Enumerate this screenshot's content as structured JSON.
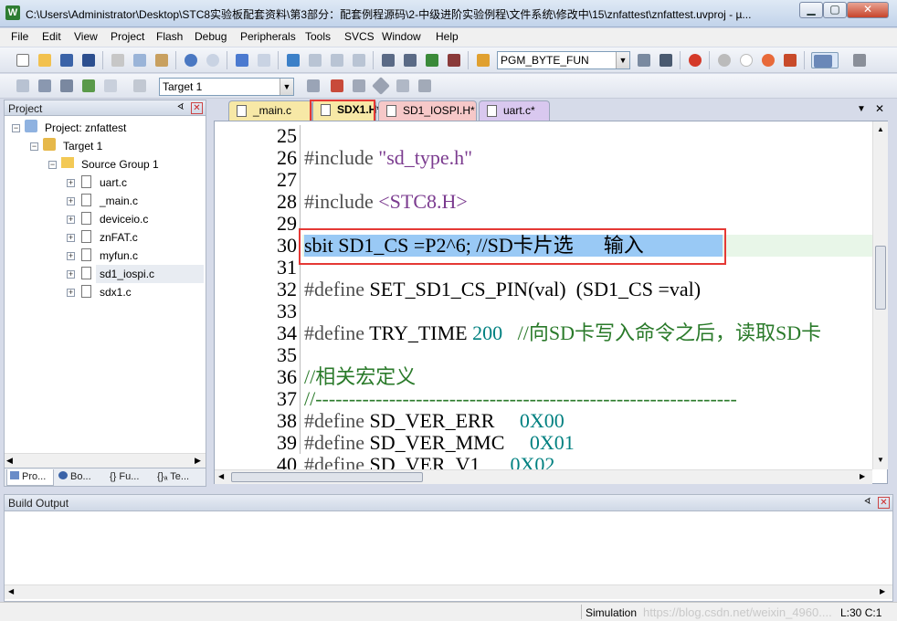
{
  "window": {
    "title": "C:\\Users\\Administrator\\Desktop\\STC8实验板配套资料\\第3部分：配套例程源码\\2-中级进阶实验例程\\文件系统\\修改中\\15\\znfattest\\znfattest.uvproj - µ...",
    "app_icon": "W",
    "minimize_icon": "minimize-icon",
    "maximize_icon": "maximize-icon",
    "close_icon": "close-icon"
  },
  "menu": [
    "File",
    "Edit",
    "View",
    "Project",
    "Flash",
    "Debug",
    "Peripherals",
    "Tools",
    "SVCS",
    "Window",
    "Help"
  ],
  "toolbar": {
    "function_combo": "PGM_BYTE_FUN",
    "target_combo": "Target 1"
  },
  "project_panel": {
    "title": "Project",
    "pin_glyph": "ᗏ",
    "close_glyph": "✕",
    "tree": {
      "project": "Project: znfattest",
      "target": "Target 1",
      "group": "Source Group 1",
      "files": [
        "uart.c",
        "_main.c",
        "deviceio.c",
        "znFAT.c",
        "myfun.c",
        "sd1_iospi.c",
        "sdx1.c"
      ],
      "collapse_glyph": "−",
      "expand_glyph": "+"
    },
    "bottom_tabs": [
      "Pro...",
      "Bo...",
      "{} Fu...",
      "{}ₐ Te..."
    ]
  },
  "editor": {
    "tabs": [
      {
        "label": "_main.c",
        "color": "#f7e8a6"
      },
      {
        "label": "SDX1.H*",
        "color": "#f7e8a6",
        "active": true
      },
      {
        "label": "SD1_IOSPI.H*",
        "color": "#f6c8c8"
      },
      {
        "label": "uart.c*",
        "color": "#d9c8ef"
      }
    ],
    "tab_menu_glyph": "▼",
    "tab_close_glyph": "✕",
    "line_numbers": [
      "25",
      "26",
      "27",
      "28",
      "29",
      "30",
      "31",
      "32",
      "33",
      "34",
      "35",
      "36",
      "37",
      "38",
      "39",
      "40"
    ],
    "lines": {
      "l26_kw": "#include",
      "l26_str": " \"sd_type.h\"",
      "l28_kw": "#include",
      "l28_str": " <STC8.H>",
      "l30": "sbit SD1_CS =P2^6; //SD卡片选      输入",
      "l32_kw": "#define",
      "l32_rest": " SET_SD1_CS_PIN(val)  (SD1_CS =val)",
      "l34_kw": "#define",
      "l34_name": " TRY_TIME",
      "l34_num": " 200",
      "l34_cmt": "   //向SD卡写入命令之后，读取SD卡",
      "l36_cmt": "//相关宏定义",
      "l37_cmt": "//---------------------------------------------------------------",
      "l38_kw": "#define",
      "l38_name": " SD_VER_ERR     ",
      "l38_num": "0X00",
      "l39_kw": "#define",
      "l39_name": " SD_VER_MMC     ",
      "l39_num": "0X01",
      "l40_kw": "#define",
      "l40_name": " SD_VER_V1      ",
      "l40_num": "0X02"
    },
    "highlight_color": "#99c9f5",
    "annotation_color": "#e53935"
  },
  "build_output": {
    "title": "Build Output",
    "pin_glyph": "ᗏ",
    "close_glyph": "✕"
  },
  "status": {
    "mode": "Simulation",
    "watermark": "https://blog.csdn.net/weixin_4960....",
    "position": "L:30 C:1"
  }
}
